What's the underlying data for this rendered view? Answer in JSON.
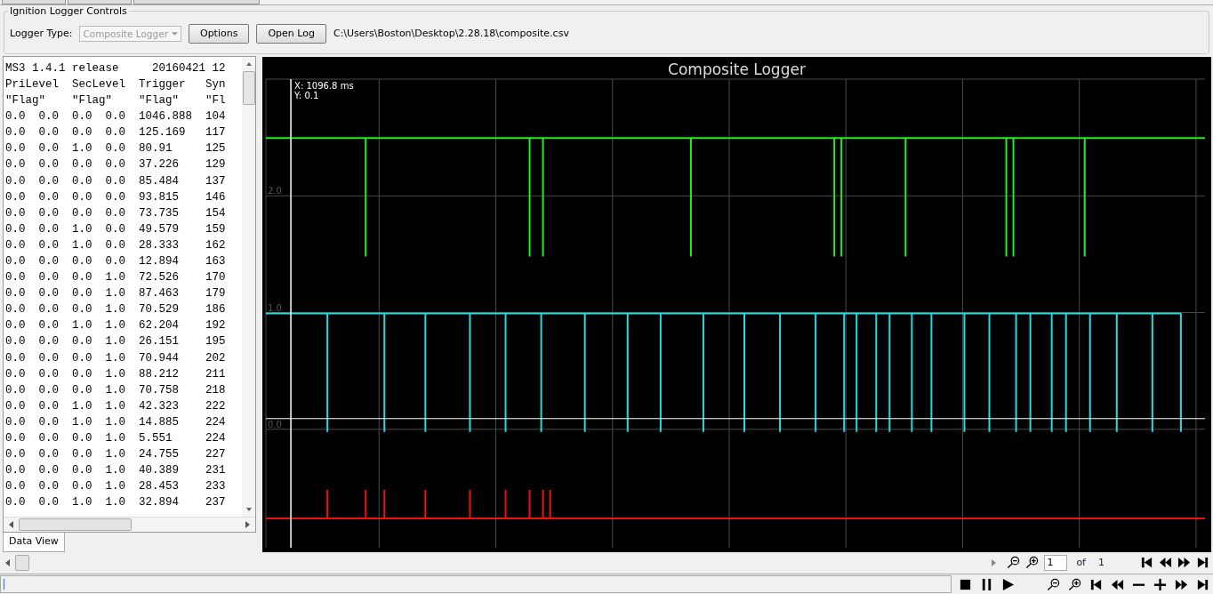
{
  "controls": {
    "legend": "Ignition Logger Controls",
    "logger_type_label": "Logger Type:",
    "logger_type": {
      "value": "Composite Logger",
      "disabled": true
    },
    "buttons": [
      "Options",
      "Open Log"
    ],
    "file_path": "C:\\Users\\Boston\\Desktop\\2.28.18\\composite.csv"
  },
  "data_view": {
    "lines": [
      "MS3 1.4.1 release     20160421 12",
      "PriLevel  SecLevel  Trigger   Syn",
      "\"Flag\"    \"Flag\"    \"Flag\"    \"Fl",
      "0.0  0.0  0.0  0.0  1046.888  104",
      "0.0  0.0  0.0  0.0  125.169   117",
      "0.0  0.0  1.0  0.0  80.91     125",
      "0.0  0.0  0.0  0.0  37.226    129",
      "0.0  0.0  0.0  0.0  85.484    137",
      "0.0  0.0  0.0  0.0  93.815    146",
      "0.0  0.0  0.0  0.0  73.735    154",
      "0.0  0.0  1.0  0.0  49.579    159",
      "0.0  0.0  1.0  0.0  28.333    162",
      "0.0  0.0  0.0  0.0  12.894    163",
      "0.0  0.0  0.0  1.0  72.526    170",
      "0.0  0.0  0.0  1.0  87.463    179",
      "0.0  0.0  0.0  1.0  70.529    186",
      "0.0  0.0  1.0  1.0  62.204    192",
      "0.0  0.0  0.0  1.0  26.151    195",
      "0.0  0.0  0.0  1.0  70.944    202",
      "0.0  0.0  0.0  1.0  88.212    211",
      "0.0  0.0  0.0  1.0  70.758    218",
      "0.0  0.0  1.0  1.0  42.323    222",
      "0.0  0.0  1.0  1.0  14.885    224",
      "0.0  0.0  0.0  1.0  5.551     224",
      "0.0  0.0  0.0  1.0  24.755    227",
      "0.0  0.0  0.0  1.0  40.389    231",
      "0.0  0.0  0.0  1.0  28.453    233",
      "0.0  0.0  1.0  1.0  32.894    237"
    ],
    "tabs": [
      {
        "label": "Data View",
        "selected": true
      }
    ]
  },
  "chart": {
    "title": "Composite Logger",
    "cursor_x": "X: 1096.8 ms",
    "cursor_y": "Y: 0.1",
    "tick_labels": [
      "2.0",
      "1.0",
      "0.0"
    ]
  },
  "pager": {
    "page": "1",
    "of_label": "of",
    "total": "1"
  }
}
